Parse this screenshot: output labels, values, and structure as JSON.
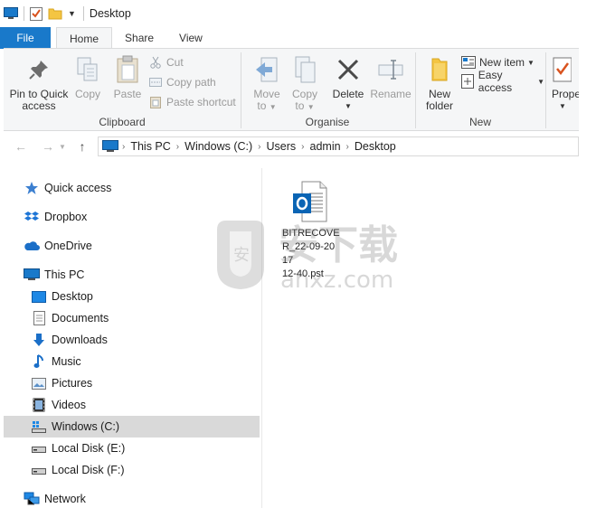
{
  "window": {
    "title": "Desktop"
  },
  "ribbon": {
    "tabs": [
      {
        "label": "File"
      },
      {
        "label": "Home"
      },
      {
        "label": "Share"
      },
      {
        "label": "View"
      }
    ],
    "clipboard": {
      "group_label": "Clipboard",
      "pin_label_1": "Pin to Quick",
      "pin_label_2": "access",
      "copy_label": "Copy",
      "paste_label": "Paste",
      "cut_label": "Cut",
      "copy_path_label": "Copy path",
      "paste_shortcut_label": "Paste shortcut"
    },
    "organise": {
      "group_label": "Organise",
      "move_to_label_1": "Move",
      "move_to_label_2": "to",
      "copy_to_label_1": "Copy",
      "copy_to_label_2": "to",
      "delete_label": "Delete",
      "rename_label": "Rename"
    },
    "new": {
      "group_label": "New",
      "new_folder_label_1": "New",
      "new_folder_label_2": "folder",
      "new_item_label": "New item",
      "easy_access_label": "Easy access"
    },
    "open": {
      "properties_label": "Prope"
    }
  },
  "address_bar": {
    "crumbs": [
      "This PC",
      "Windows (C:)",
      "Users",
      "admin",
      "Desktop"
    ]
  },
  "nav_pane": {
    "items": [
      {
        "label": "Quick access",
        "icon": "star-icon"
      },
      {
        "label": "Dropbox",
        "icon": "dropbox-icon"
      },
      {
        "label": "OneDrive",
        "icon": "cloud-icon"
      },
      {
        "label": "This PC",
        "icon": "computer-icon"
      },
      {
        "label": "Desktop",
        "icon": "desktop-icon"
      },
      {
        "label": "Documents",
        "icon": "document-icon"
      },
      {
        "label": "Downloads",
        "icon": "download-icon"
      },
      {
        "label": "Music",
        "icon": "music-icon"
      },
      {
        "label": "Pictures",
        "icon": "picture-icon"
      },
      {
        "label": "Videos",
        "icon": "video-icon"
      },
      {
        "label": "Windows (C:)",
        "icon": "drive-icon",
        "selected": true
      },
      {
        "label": "Local Disk (E:)",
        "icon": "drive-icon"
      },
      {
        "label": "Local Disk (F:)",
        "icon": "drive-icon"
      },
      {
        "label": "Network",
        "icon": "network-icon"
      }
    ]
  },
  "files": [
    {
      "name": "BITRECOVER_22-09-2017 12-40.pst",
      "lines": [
        "BITRECOVE",
        "R_22-09-20",
        "17",
        "12-40.pst"
      ],
      "icon": "outlook-pst-icon"
    }
  ],
  "watermark": {
    "text_cn": "安下载",
    "text_en": "anxz.com"
  },
  "colors": {
    "file_tab": "#1979ca",
    "selection": "#d9d9d9",
    "ribbon_bg": "#f5f6f7",
    "folder": "#f4c542",
    "accent_blue": "#1979ca",
    "delete_x": "#4a4a4a",
    "check_orange": "#d9531e"
  }
}
